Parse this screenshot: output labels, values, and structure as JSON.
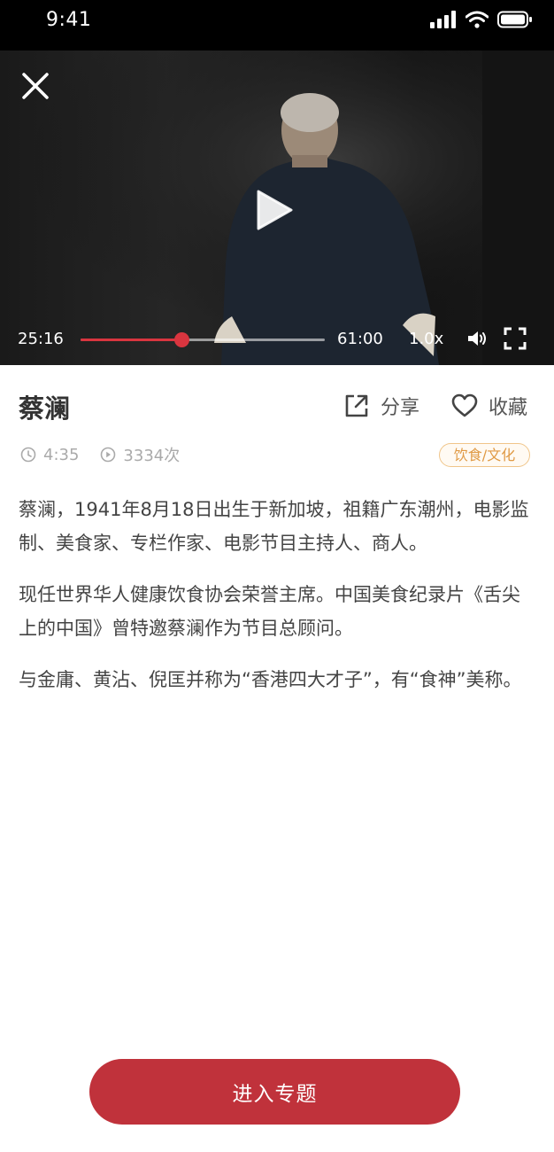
{
  "status_bar": {
    "time": "9:41"
  },
  "player": {
    "current_time": "25:16",
    "total_time": "61:00",
    "speed": "1.0x",
    "progress": 0.4142,
    "accent_color": "#d9353f"
  },
  "video_info": {
    "title": "蔡澜",
    "share_label": "分享",
    "favorite_label": "收藏",
    "duration": "4:35",
    "views": "3334次",
    "category": "饮食/文化"
  },
  "description": [
    "蔡澜，1941年8月18日出生于新加坡，祖籍广东潮州，电影监制、美食家、专栏作家、电影节目主持人、商人。",
    "现任世界华人健康饮食协会荣誉主席。中国美食纪录片《舌尖上的中国》曾特邀蔡澜作为节目总顾问。",
    "与金庸、黄沾、倪匡并称为“香港四大才子”，有“食神”美称。"
  ],
  "footer": {
    "enter_label": "进入专题",
    "button_color": "#c0323b"
  },
  "icons": [
    "signal-icon",
    "wifi-icon",
    "battery-icon",
    "close-icon",
    "play-icon",
    "volume-icon",
    "fullscreen-icon",
    "share-icon",
    "heart-icon",
    "clock-icon",
    "play-count-icon"
  ]
}
